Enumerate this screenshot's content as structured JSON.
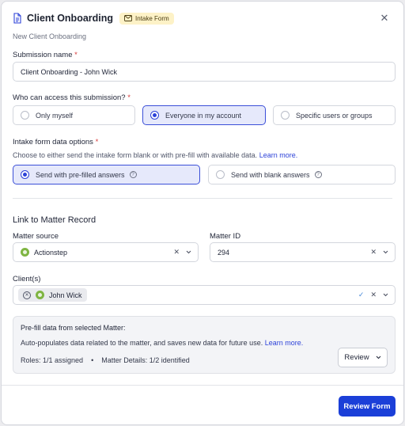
{
  "header": {
    "title": "Client Onboarding",
    "badge": "Intake Form",
    "subtitle": "New Client Onboarding"
  },
  "submission_name": {
    "label": "Submission name",
    "required_mark": "*",
    "value": "Client Onboarding - John Wick"
  },
  "access": {
    "label": "Who can access this submission?",
    "required_mark": "*",
    "options": [
      "Only myself",
      "Everyone in my account",
      "Specific users or groups"
    ],
    "selected": "Everyone in my account"
  },
  "intake": {
    "label": "Intake form data options",
    "required_mark": "*",
    "description": "Choose to either send the intake form blank or with pre-fill with available data.",
    "learn_more": "Learn more.",
    "options": [
      "Send with pre-filled answers",
      "Send with blank answers"
    ],
    "selected": "Send with pre-filled answers",
    "help_glyph": "?"
  },
  "matter": {
    "section_title": "Link to Matter Record",
    "source_label": "Matter source",
    "source_value": "Actionstep",
    "id_label": "Matter ID",
    "id_value": "294",
    "clients_label": "Client(s)",
    "client_chip": "John Wick"
  },
  "prefill": {
    "title": "Pre-fill data from selected Matter:",
    "description": "Auto-populates data related to the matter, and saves new data for future use.",
    "learn_more": "Learn more.",
    "roles": "Roles: 1/1 assigned",
    "bullet": "•",
    "details": "Matter Details: 1/2 identified",
    "review_label": "Review"
  },
  "footer": {
    "primary_label": "Review Form"
  },
  "colors": {
    "accent": "#1b3fd8",
    "badge_bg": "#fdf2c7",
    "selected_bg": "#e6e9fb",
    "required": "#d63b3b",
    "source_dot": "#7fb542"
  },
  "icons": {
    "title": "document-icon",
    "badge": "mail-icon",
    "close": "close-icon",
    "help": "help-circle-icon",
    "clear": "clear-x-icon",
    "dropdown": "chevron-down-icon",
    "check": "check-icon",
    "chip_remove": "remove-circle-icon"
  }
}
